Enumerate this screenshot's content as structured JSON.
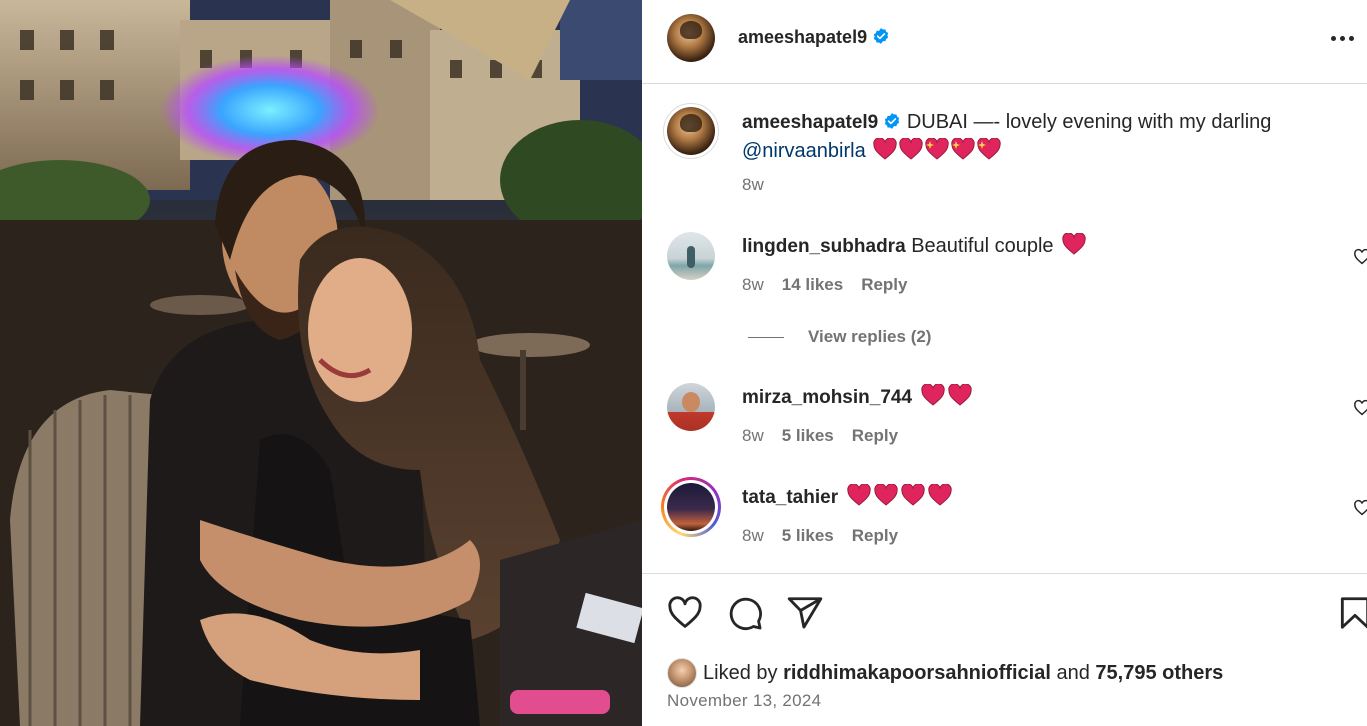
{
  "post": {
    "username": "ameeshapatel9",
    "verified": true,
    "caption": {
      "text": "DUBAI —- lovely evening with my darling",
      "mention": "@nirvaanbirla",
      "age": "8w"
    }
  },
  "comments": [
    {
      "username": "lingden_subhadra",
      "text": "Beautiful couple",
      "age": "8w",
      "likes": "14 likes",
      "reply": "Reply"
    },
    {
      "username": "mirza_mohsin_744",
      "text": "",
      "age": "8w",
      "likes": "5 likes",
      "reply": "Reply"
    },
    {
      "username": "tata_tahier",
      "text": "",
      "age": "8w",
      "likes": "5 likes",
      "reply": "Reply"
    }
  ],
  "view_replies": "View replies (2)",
  "likes": {
    "prefix": "Liked by",
    "user": "riddhimakapoorsahniofficial",
    "and": "and",
    "others": "75,795 others"
  },
  "date": "November 13, 2024",
  "icons": [
    "more-icon",
    "verified-badge-icon",
    "heart-icon",
    "comment-icon",
    "share-icon",
    "bookmark-icon",
    "red-heart-emoji",
    "sparkling-heart-emoji"
  ],
  "colors": {
    "text": "#262626",
    "muted": "#737373",
    "mention": "#00376b",
    "verified": "#0095f6",
    "heart": "#e0245e",
    "border": "#dbdbdb"
  }
}
